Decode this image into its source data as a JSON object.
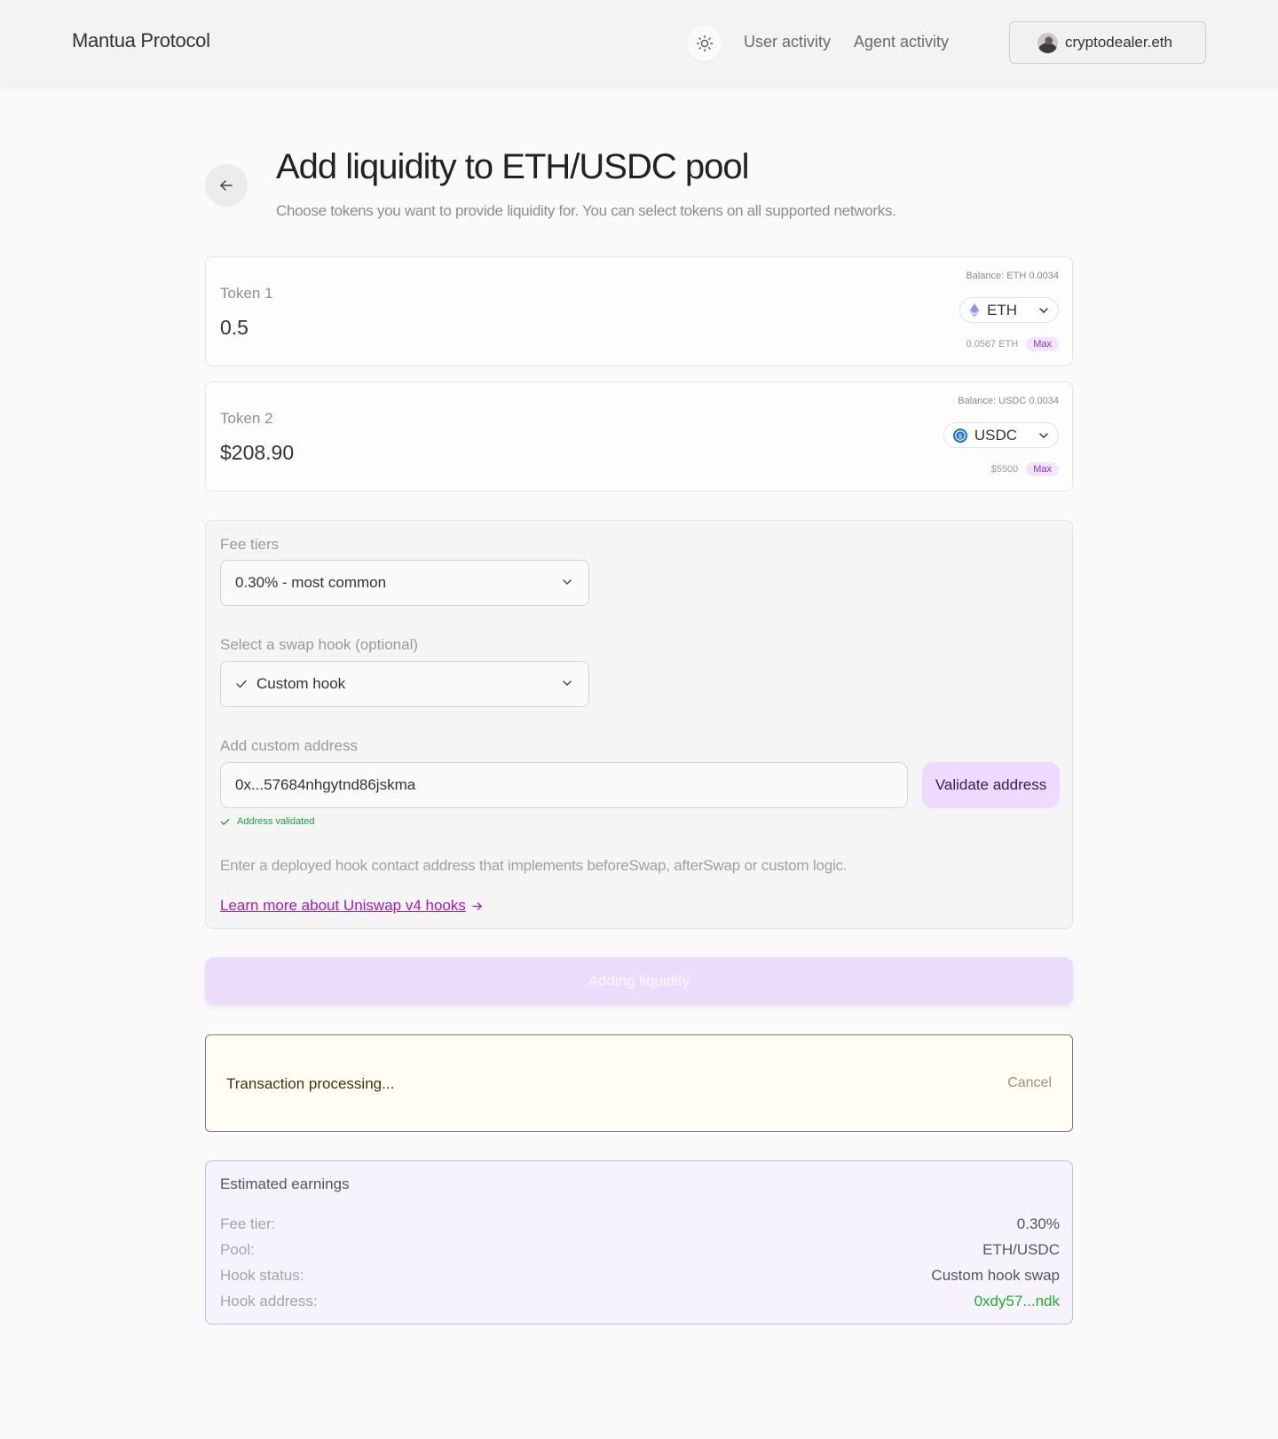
{
  "header": {
    "brand": "Mantua Protocol",
    "theme_toggle_icon": "sun-icon",
    "nav": [
      "User activity",
      "Agent activity"
    ],
    "user": {
      "name": "cryptodealer.eth"
    }
  },
  "page": {
    "title": "Add liquidity to ETH/USDC pool",
    "subtitle": "Choose tokens you want to provide liquidity for. You can select tokens on all supported networks."
  },
  "tokens": [
    {
      "label": "Token 1",
      "amount": "0.5",
      "balance": "Balance: ETH 0.0034",
      "symbol": "ETH",
      "icon": "eth-icon",
      "sub_value": "0.0567 ETH",
      "max_label": "Max"
    },
    {
      "label": "Token 2",
      "amount": "$208.90",
      "balance": "Balance: USDC 0.0034",
      "symbol": "USDC",
      "icon": "usdc-icon",
      "sub_value": "$5500",
      "max_label": "Max"
    }
  ],
  "settings": {
    "fee_label": "Fee tiers",
    "fee_value": "0.30% - most common",
    "hook_label": "Select a swap hook (optional)",
    "hook_value": "Custom hook",
    "address_label": "Add custom address",
    "address_value": "0x...57684nhgytnd86jskma",
    "validate_label": "Validate address",
    "validated_text": "Address validated",
    "hint": "Enter a deployed hook contact address that implements beforeSwap, afterSwap or custom logic.",
    "learn_more": "Learn more about Uniswap v4 hooks"
  },
  "action": {
    "label": "Adding liquidity"
  },
  "transaction": {
    "status": "Transaction processing...",
    "cancel": "Cancel"
  },
  "earnings": {
    "title": "Estimated earnings",
    "rows": [
      {
        "key": "Fee tier:",
        "value": "0.30%"
      },
      {
        "key": "Pool:",
        "value": "ETH/USDC"
      },
      {
        "key": "Hook status:",
        "value": "Custom hook swap"
      },
      {
        "key": "Hook address:",
        "value": "0xdy57...ndk"
      }
    ]
  },
  "colors": {
    "accent": "#eedafc",
    "link": "#a51ab8",
    "success": "#1fb12a"
  }
}
